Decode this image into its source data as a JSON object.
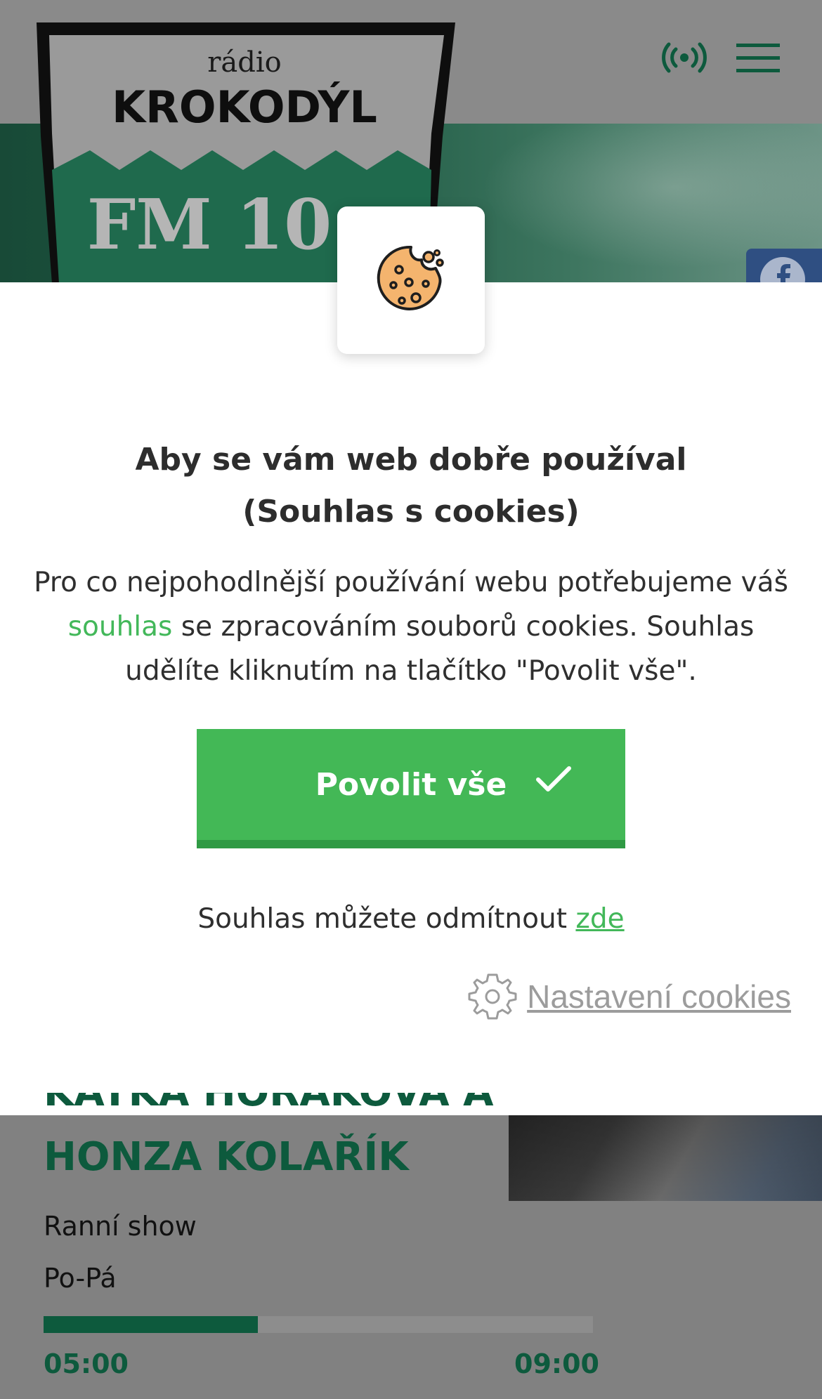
{
  "logo": {
    "line1": "rádio",
    "line2": "KROKODÝL",
    "line3": "FM 10"
  },
  "header": {
    "live_icon": "broadcast-icon",
    "menu_icon": "hamburger-menu-icon"
  },
  "social": {
    "icon": "facebook-icon"
  },
  "cookie_modal": {
    "icon": "cookie-icon",
    "title": "Aby se vám web dobře používal (Souhlas s cookies)",
    "text_before_link": "Pro co nejpohodlnější používání webu potřebujeme váš ",
    "link_text": "souhlas",
    "text_after_link": " se zpracováním souborů cookies. Souhlas udělíte kliknutím na tlačítko \"Povolit vše\".",
    "allow_button_label": "Povolit vše",
    "decline_text": "Souhlas můžete odmítnout ",
    "decline_link": "zde",
    "settings_label": "Nastavení cookies"
  },
  "now_playing": {
    "hosts_line1": "KATKA HORÁKOVÁ A",
    "hosts_line2": "HONZA KOLAŘÍK",
    "show_name": "Ranní show",
    "days": "Po-Pá",
    "start_time": "05:00",
    "end_time": "09:00",
    "progress_fraction": 0.39
  },
  "colors": {
    "brand_green": "#0d5a3d",
    "accent_green": "#43b856",
    "link_green": "#43b85a"
  }
}
